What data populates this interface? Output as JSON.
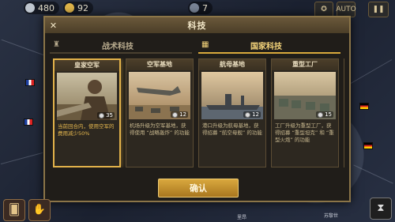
{
  "hud": {
    "gold": "480",
    "industry": "92",
    "turn": "7",
    "auto_label": "AUTO",
    "pause_icon": "pause-icon",
    "medal_icon": "medal-icon"
  },
  "dialog": {
    "title": "科技",
    "close_icon": "close-icon",
    "tabs": [
      {
        "label": "战术科技",
        "selected": false
      },
      {
        "label": "国家科技",
        "selected": true
      }
    ],
    "cards": [
      {
        "name": "皇家空军",
        "cost": "35",
        "desc": "当前回合内，使用空军的费用减少50%",
        "selected": true
      },
      {
        "name": "空军基地",
        "cost": "12",
        "desc": "机场升级为空军基地，获得使用 “战略轰炸” 的功能",
        "selected": false
      },
      {
        "name": "航母基地",
        "cost": "12",
        "desc": "港口升级为航母基地，获得招募 “航空母舰” 的功能",
        "selected": false
      },
      {
        "name": "重型工厂",
        "cost": "15",
        "desc": "工厂升级为重型工厂，获得招募 “重型坦克” 和 “重型火炮” 的功能",
        "selected": false
      }
    ],
    "confirm_label": "确认"
  },
  "map": {
    "labels": [
      "苏黎世",
      "里昂"
    ]
  },
  "colors": {
    "accent": "#d9a93c",
    "frame": "#8b7548"
  }
}
